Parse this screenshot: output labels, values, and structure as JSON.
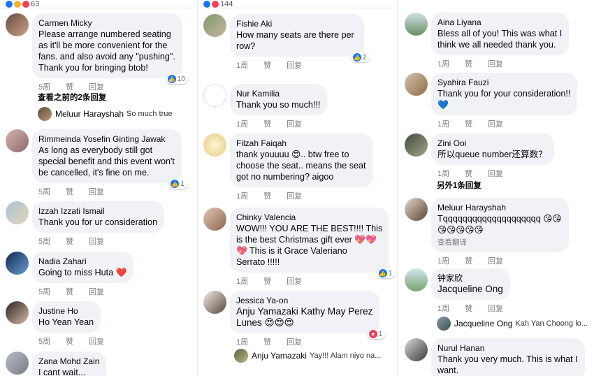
{
  "colA": {
    "topbar_count": "63",
    "comments": [
      {
        "name": "Carmen Micky",
        "text": "Please arrange numbered seating\nas it'll be more convenient for the\nfans. and also avoid any \"pushing\".\nThank you for bringing btob!",
        "time": "5周",
        "like": "赞",
        "reply": "回复",
        "reactions": "10"
      },
      {
        "name": "Rimmeinda Yosefin Ginting Jawak",
        "text": "As long as everybody still got\nspecial benefit and this event won't\nbe cancelled, it's fine on me.",
        "time": "5周",
        "like": "赞",
        "reply": "回复",
        "reactions": "1"
      },
      {
        "name": "Izzah Izzati Ismail",
        "text": "Thank you for ur consideration",
        "time": "5周",
        "like": "赞",
        "reply": "回复"
      },
      {
        "name": "Nadia Zahari",
        "text": "Going to miss Huta ❤️",
        "time": "5周",
        "like": "赞",
        "reply": "回复"
      },
      {
        "name": "Justine  Ho",
        "text": "Ho Yean Yean",
        "time": "5周",
        "like": "赞",
        "reply": "回复"
      },
      {
        "name": "Zana Mohd Zain",
        "text": "I cant wait..."
      }
    ],
    "more_replies": "查看之前的2条回复",
    "reply": {
      "name": "Meluur Harayshah",
      "text": "So much true"
    }
  },
  "colB": {
    "topbar_count": "144",
    "comments": [
      {
        "name": "Fishie Aki",
        "text": "How many seats are there per\nrow?",
        "time": "1周",
        "like": "赞",
        "reply": "回复",
        "reactions": "2"
      },
      {
        "name": "Nur Kamilia",
        "text": "Thank you so much!!!",
        "time": "1周",
        "like": "赞",
        "reply": "回复"
      },
      {
        "name": "Filzah Faiqah",
        "text": "thank youuuu 😍.. btw free to\nchoose the seat.. means the seat\ngot no numbering? aigoo",
        "time": "1周",
        "like": "赞",
        "reply": "回复"
      },
      {
        "name": "Chinky Valencia",
        "text": "WOW!!! YOU ARE THE BEST!!!! This\nis the best Christmas gift ever 💖💖\n💖 This is it  Grace Valeriano\nSerrato !!!!!",
        "time": "1周",
        "like": "赞",
        "reply": "回复",
        "reactions": "1"
      },
      {
        "name": "Jessica Ya-on",
        "text": "Anju Yamazaki Kathy May Perez\nLunes 😍😍😍",
        "time": "1周",
        "like": "赞",
        "reply": "回复",
        "reactions": "1"
      }
    ],
    "reply": {
      "name": "Anju Yamazaki",
      "text": "Yay!!! Alam niyo na..."
    }
  },
  "colC": {
    "comments": [
      {
        "name": "Aina Liyana",
        "text": "Bless all of you! This was what I\nthink we all needed thank you.",
        "time": "1周",
        "like": "赞",
        "reply": "回复"
      },
      {
        "name": "Syahira Fauzi",
        "text": "Thank you for your consideration!!\n💙",
        "time": "1周",
        "like": "赞",
        "reply": "回复"
      },
      {
        "name": "Zini Ooi",
        "text": "所以queue number还算数？",
        "time": "1周",
        "like": "赞",
        "reply": "回复"
      },
      {
        "name": "Meluur Harayshah",
        "text": "Tqqqqqqqqqqqqqqqqqqqq 😘😘\n😘😘😘😘😘",
        "see_translation": "查看翻译",
        "time": "1周",
        "like": "赞",
        "reply": "回复"
      },
      {
        "name": "钟家欣",
        "text": "Jacqueline Ong",
        "time": "1周",
        "like": "赞",
        "reply": "回复"
      },
      {
        "name": "Nurul Hanan",
        "text": "Thank you very much. This is what I\nwant."
      }
    ],
    "more_replies": "另外1条回复",
    "reply": {
      "name": "Jacqueline Ong",
      "text": "Kah Yan Choong lo..."
    }
  }
}
